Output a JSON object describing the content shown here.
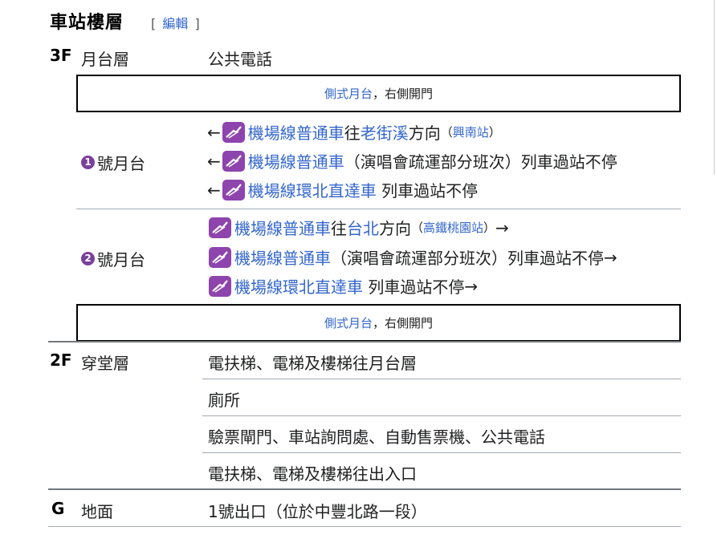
{
  "heading": "車站樓層",
  "edit_link": "編輯",
  "edit_bracket_open": "[",
  "edit_bracket_close": "]",
  "platform_box": {
    "link": "側式月台",
    "comma": "，",
    "text": "右側開門"
  },
  "floors": {
    "f3": {
      "label": "3F",
      "name": "月台層",
      "facility": "公共電話"
    },
    "f2": {
      "label": "2F",
      "name": "穿堂層",
      "items": [
        "電扶梯、電梯及樓梯往月台層",
        "廁所",
        "驗票閘門、車站詢問處、自動售票機、公共電話",
        "電扶梯、電梯及樓梯往出入口"
      ]
    },
    "g": {
      "label": "G",
      "name": "地面",
      "exit": "1號出口（位於中豐北路一段）"
    }
  },
  "platform1": {
    "number": "1",
    "label": "號月台",
    "arrow": "←",
    "rows": [
      {
        "line": "機場線普通車",
        "mid": "往",
        "dest": "老街溪",
        "suffix": "方向",
        "paren_open": "（",
        "sub": "興南站",
        "paren_close": "）"
      },
      {
        "line": "機場線普通車",
        "text": "（演唱會疏運部分班次）列車過站不停"
      },
      {
        "line": "機場線環北直達車",
        "text": " 列車過站不停"
      }
    ]
  },
  "platform2": {
    "number": "2",
    "label": "號月台",
    "arrow": "→",
    "rows": [
      {
        "line": "機場線普通車",
        "mid": "往",
        "dest": "台北",
        "suffix": "方向",
        "paren_open": "（",
        "sub": "高鐵桃園站",
        "paren_close": "）"
      },
      {
        "line": "機場線普通車",
        "text": "（演唱會疏運部分班次）列車過站不停"
      },
      {
        "line": "機場線環北直達車",
        "text": " 列車過站不停"
      }
    ]
  },
  "colors": {
    "link": "#3366cc",
    "line_logo": "#8e44ad",
    "border": "#a2a9b1"
  },
  "icons": {
    "line_logo": "airport-mrt-logo-icon"
  }
}
